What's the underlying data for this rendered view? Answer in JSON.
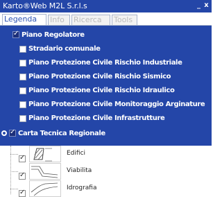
{
  "window": {
    "title": "Karto®Web M2L S.r.l.s",
    "minimize_glyph": "_",
    "close_glyph": "x"
  },
  "tabs": [
    {
      "label": "Legenda",
      "active": true
    },
    {
      "label": "Info",
      "active": false
    },
    {
      "label": "Ricerca",
      "active": false
    },
    {
      "label": "Tools",
      "active": false
    }
  ],
  "layers": [
    {
      "label": "Piano Regolatore",
      "checked": true,
      "level": 0,
      "expander": false
    },
    {
      "label": "Stradario comunale",
      "checked": false,
      "level": 1
    },
    {
      "label": "Piano Protezione Civile Rischio Industriale",
      "checked": false,
      "level": 1
    },
    {
      "label": "Piano Protezione Civile Rischio Sismico",
      "checked": false,
      "level": 1
    },
    {
      "label": "Piano Protezione Civile Rischio Idraulico",
      "checked": false,
      "level": 1
    },
    {
      "label": "Piano Protezione Civile Monitoraggio Arginature",
      "checked": false,
      "level": 1
    },
    {
      "label": "Piano Protezione Civile Infrastrutture",
      "checked": false,
      "level": 1
    },
    {
      "label": "Carta Tecnica Regionale",
      "checked": true,
      "level": 0,
      "expander": true
    }
  ],
  "legend_items": [
    {
      "label": "Edifici",
      "checked": true,
      "icon": "hatched-building-icon"
    },
    {
      "label": "Viabilita",
      "checked": true,
      "icon": "road-lines-icon"
    },
    {
      "label": "Idrografia",
      "checked": true,
      "icon": "river-lines-icon"
    }
  ],
  "colors": {
    "title_bar": "#2446a8",
    "layer_panel": "#2446a8",
    "active_tab_text": "#2f56b4"
  }
}
